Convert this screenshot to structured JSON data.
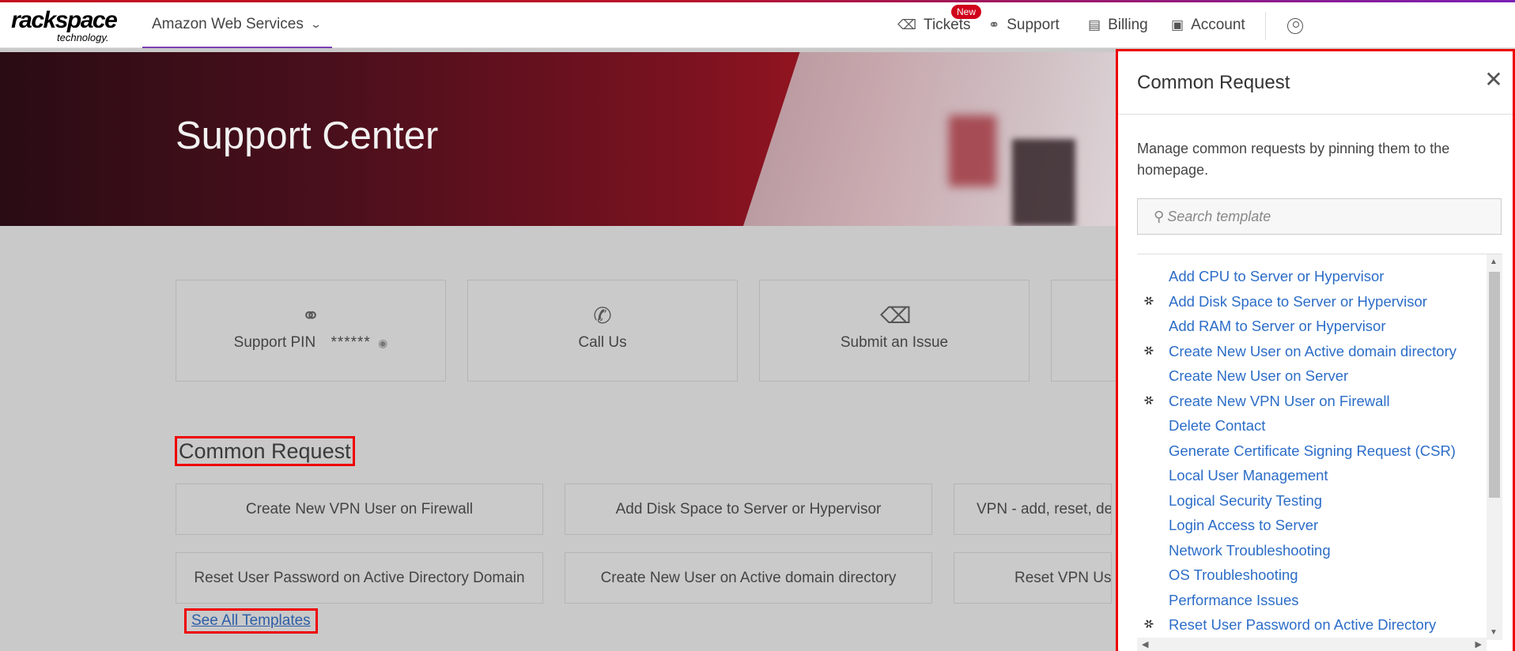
{
  "header": {
    "logo_main": "rackspace",
    "logo_sub": "technology.",
    "account_label": "Amazon Web Services",
    "nav": {
      "tickets": "Tickets",
      "tickets_badge": "New",
      "support": "Support",
      "billing": "Billing",
      "account": "Account"
    }
  },
  "hero": {
    "title": "Support Center"
  },
  "cards": {
    "pin_label": "Support PIN",
    "pin_value": "******",
    "call_label": "Call Us",
    "issue_label": "Submit an Issue"
  },
  "common": {
    "title": "Common Request",
    "buttons": [
      "Create New VPN User on Firewall",
      "Add Disk Space to Server or Hypervisor",
      "VPN - add, reset, dele",
      "Reset User Password on Active Directory Domain",
      "Create New User on Active domain directory",
      "Reset VPN User"
    ],
    "see_all": "See All Templates"
  },
  "panel": {
    "title": "Common Request",
    "description": "Manage common requests by pinning them to the homepage.",
    "search_placeholder": "Search template",
    "items": [
      {
        "label": "Add CPU to Server or Hypervisor",
        "pinned": false
      },
      {
        "label": "Add Disk Space to Server or Hypervisor",
        "pinned": true
      },
      {
        "label": "Add RAM to Server or Hypervisor",
        "pinned": false
      },
      {
        "label": "Create New User on Active domain directory",
        "pinned": true
      },
      {
        "label": "Create New User on Server",
        "pinned": false
      },
      {
        "label": "Create New VPN User on Firewall",
        "pinned": true
      },
      {
        "label": "Delete Contact",
        "pinned": false
      },
      {
        "label": "Generate Certificate Signing Request (CSR)",
        "pinned": false
      },
      {
        "label": "Local User Management",
        "pinned": false
      },
      {
        "label": "Logical Security Testing",
        "pinned": false
      },
      {
        "label": "Login Access to Server",
        "pinned": false
      },
      {
        "label": "Network Troubleshooting",
        "pinned": false
      },
      {
        "label": "OS Troubleshooting",
        "pinned": false
      },
      {
        "label": "Performance Issues",
        "pinned": false
      },
      {
        "label": "Reset User Password on Active Directory",
        "pinned": true
      }
    ]
  },
  "colors": {
    "accent_red": "#e00000",
    "link_blue": "#2c6dc8",
    "badge_red": "#d0021b",
    "nav_underline": "#7b3fb5"
  },
  "icons": {
    "tickets": "ticket-icon",
    "support": "headset-icon",
    "billing": "receipt-icon",
    "account": "id-card-icon",
    "user": "user-circle-icon",
    "close": "close-icon",
    "search": "search-icon",
    "pin": "pin-icon"
  }
}
